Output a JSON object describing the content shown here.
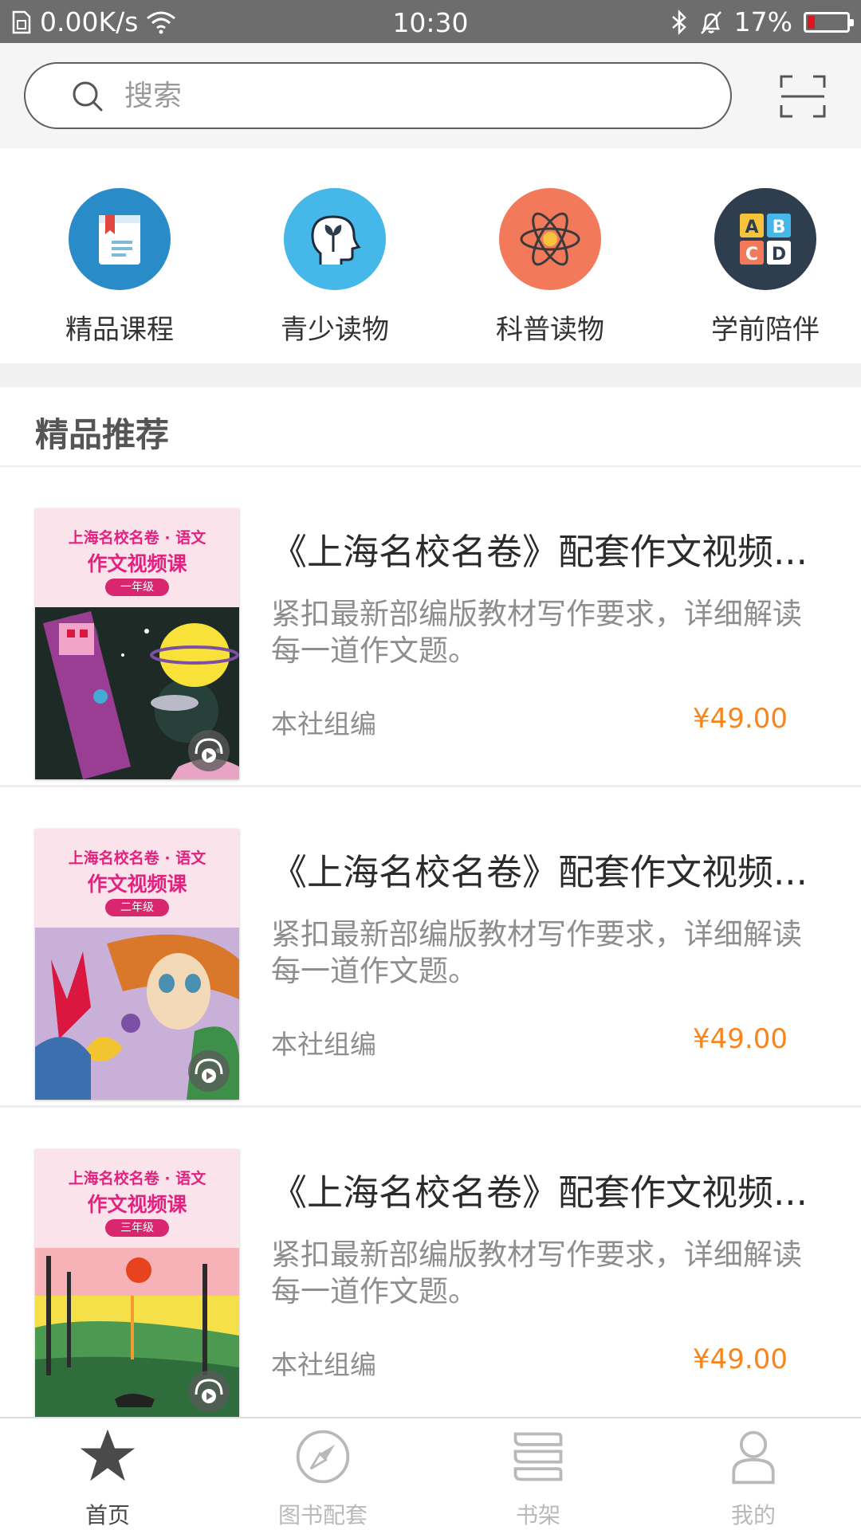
{
  "status_bar": {
    "network_speed": "0.00K/s",
    "time": "10:30",
    "battery": "17%",
    "battery_level": 0.17
  },
  "search": {
    "placeholder": "搜索"
  },
  "categories": [
    {
      "label": "精品课程",
      "icon": "book-icon",
      "color": "#2a8bc9"
    },
    {
      "label": "青少读物",
      "icon": "head-sprout-icon",
      "color": "#45b7e8"
    },
    {
      "label": "科普读物",
      "icon": "atom-icon",
      "color": "#f2795a"
    },
    {
      "label": "学前陪伴",
      "icon": "abcd-blocks-icon",
      "color": "#2f3e4f"
    }
  ],
  "section": {
    "title": "精品推荐"
  },
  "items": [
    {
      "cover_line1": "上海名校名卷 · 语文",
      "cover_line2": "作文视频课",
      "grade": "一年级",
      "title": "《上海名校名卷》配套作文视频...",
      "description": "紧扣最新部编版教材写作要求，详细解读每一道作文题。",
      "author": "本社组编",
      "price": "¥49.00"
    },
    {
      "cover_line1": "上海名校名卷 · 语文",
      "cover_line2": "作文视频课",
      "grade": "二年级",
      "title": "《上海名校名卷》配套作文视频...",
      "description": "紧扣最新部编版教材写作要求，详细解读每一道作文题。",
      "author": "本社组编",
      "price": "¥49.00"
    },
    {
      "cover_line1": "上海名校名卷 · 语文",
      "cover_line2": "作文视频课",
      "grade": "三年级",
      "title": "《上海名校名卷》配套作文视频...",
      "description": "紧扣最新部编版教材写作要求，详细解读每一道作文题。",
      "author": "本社组编",
      "price": "¥49.00"
    }
  ],
  "tabs": [
    {
      "label": "首页",
      "icon": "star-icon",
      "active": true
    },
    {
      "label": "图书配套",
      "icon": "compass-icon",
      "active": false
    },
    {
      "label": "书架",
      "icon": "bookshelf-icon",
      "active": false
    },
    {
      "label": "我的",
      "icon": "user-icon",
      "active": false
    }
  ],
  "colors": {
    "price": "#f7851c",
    "status_bar": "#6d6d6d",
    "battery_low": "#e0141e",
    "tab_active": "#4a4a4a",
    "tab_inactive": "#b9b9b9"
  }
}
